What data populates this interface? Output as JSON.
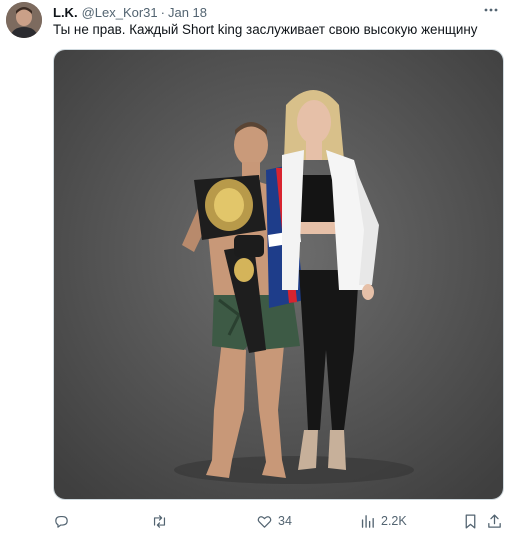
{
  "tweet": {
    "author_name": "L.K.",
    "author_handle": "@Lex_Kor31",
    "separator": "·",
    "date": "Jan 18",
    "text": "Ты не прав.  Каждый Short king заслуживает свою высокую женщину"
  },
  "icons": {
    "more": "more-horizontal-icon",
    "reply": "reply-icon",
    "retweet": "retweet-icon",
    "like": "heart-icon",
    "views": "views-chart-icon",
    "bookmark": "bookmark-icon",
    "share": "share-icon"
  },
  "actions": {
    "likes_count": "34",
    "views_count": "2.2K"
  },
  "colors": {
    "text_primary": "#0f1419",
    "text_secondary": "#536471",
    "border": "#cfd9de"
  }
}
